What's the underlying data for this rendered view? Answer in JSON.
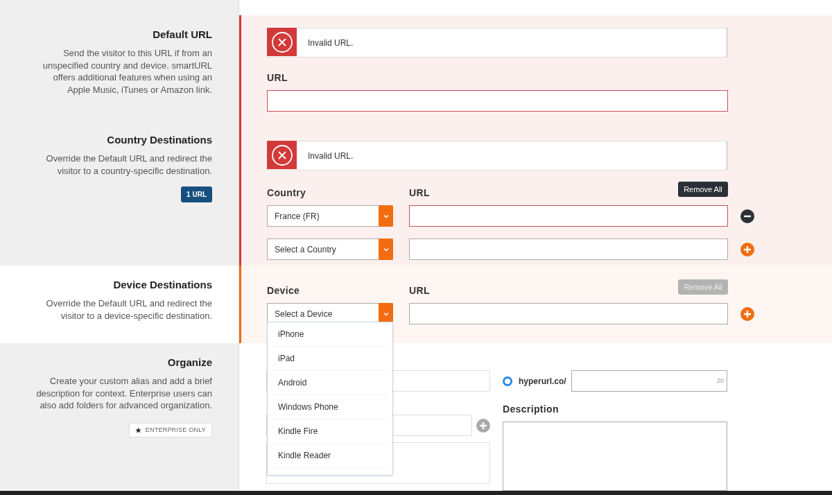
{
  "default_url": {
    "title": "Default URL",
    "description": "Send the visitor to this URL if from an unspecified country and device. smartURL offers additional features when using an Apple Music, iTunes or Amazon link.",
    "error": "Invalid URL.",
    "url_label": "URL",
    "invalid": true
  },
  "country": {
    "title": "Country Destinations",
    "description": "Override the Default URL and redirect the visitor to a country-specific destination.",
    "badge": "1 URL",
    "error": "Invalid URL.",
    "select_label": "Country",
    "url_label": "URL",
    "remove_all": {
      "label": "Remove All",
      "disabled": false
    },
    "rows": [
      {
        "value": "France (FR)",
        "invalid": true,
        "kind": "remove"
      },
      {
        "value": "Select a Country",
        "invalid": false,
        "kind": "add"
      }
    ]
  },
  "device": {
    "title": "Device Destinations",
    "description": "Override the Default URL and redirect the visitor to a device-specific destination.",
    "select_label": "Device",
    "url_label": "URL",
    "remove_all": {
      "label": "Remove All",
      "disabled": true
    },
    "rows": [
      {
        "value": "Select a Device",
        "invalid": false,
        "kind": "add"
      }
    ],
    "dropdown": {
      "expanded": true,
      "options": [
        "iPhone",
        "iPad",
        "Android",
        "Windows Phone",
        "Kindle Fire",
        "Kindle Reader"
      ]
    }
  },
  "organize": {
    "title": "Organize",
    "description": "Create your custom alias and add a brief description for context. Enterprise users can also add folders for advanced organization.",
    "badge": "ENTERPRISE ONLY",
    "alias": {
      "prefix": "hyperurl.co/",
      "selected": true,
      "counter": "20"
    },
    "description_label": "Description"
  }
}
